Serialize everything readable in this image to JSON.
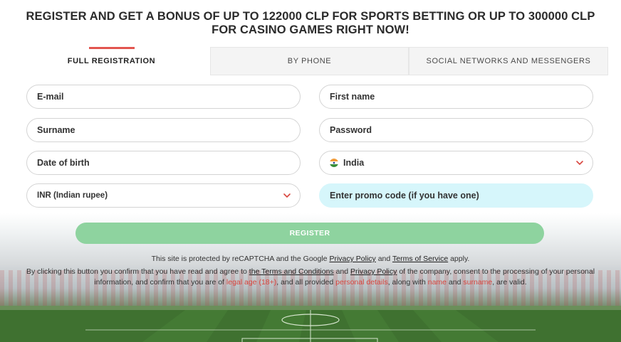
{
  "headline": "REGISTER AND GET A BONUS OF UP TO 122000 CLP FOR SPORTS BETTING OR UP TO 300000 CLP FOR CASINO GAMES RIGHT NOW!",
  "tabs": [
    {
      "label": "FULL REGISTRATION",
      "active": true
    },
    {
      "label": "BY PHONE",
      "active": false
    },
    {
      "label": "SOCIAL NETWORKS AND MESSENGERS",
      "active": false
    }
  ],
  "form": {
    "email_placeholder": "E-mail",
    "first_name_placeholder": "First name",
    "surname_placeholder": "Surname",
    "password_placeholder": "Password",
    "dob_placeholder": "Date of birth",
    "country_value": "India",
    "currency_value": "INR (Indian rupee)",
    "promo_placeholder": "Enter promo code (if you have one)",
    "register_label": "REGISTER"
  },
  "legal": {
    "recaptcha_prefix": "This site is protected by reCAPTCHA and the Google",
    "privacy_policy": "Privacy Policy",
    "and": "and",
    "terms_of_service": "Terms of Service",
    "apply": "apply.",
    "confirm_prefix": "By clicking this button you confirm that you have read and agree to",
    "terms_conditions": "the Terms and Conditions",
    "and2": "and",
    "privacy_policy2": "Privacy Policy",
    "confirm_mid": "of the company, consent to the processing of your personal information, and confirm that you are of",
    "legal_age": "legal age (18+)",
    "confirm_mid2": ", and all provided",
    "personal_details": "personal details",
    "along_with": ", along with",
    "name": "name",
    "and3": "and",
    "surname": "surname",
    "valid": ", are valid."
  },
  "colors": {
    "accent_red": "#e2554f",
    "register_green": "#8ed39f",
    "promo_bg": "#d6f6fb"
  }
}
